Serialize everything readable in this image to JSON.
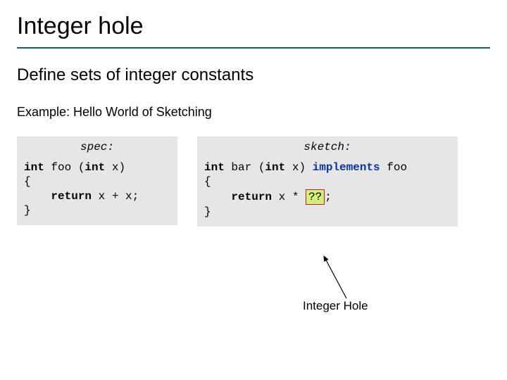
{
  "title": "Integer hole",
  "subtitle": "Define sets of integer constants",
  "example_label": "Example: Hello World of Sketching",
  "left": {
    "label": "spec:",
    "l1a": "int",
    "l1b": " foo (",
    "l1c": "int",
    "l1d": " x)",
    "l2": "{",
    "l3a": "    ",
    "l3b": "return",
    "l3c": " x + x;",
    "l4": "}"
  },
  "right": {
    "label": "sketch:",
    "l1a": "int",
    "l1b": " bar (",
    "l1c": "int",
    "l1d": " x) ",
    "l1e": "implements",
    "l1f": " foo",
    "l2": "{",
    "l3a": "    ",
    "l3b": "return",
    "l3c": " x * ",
    "l3d": "??",
    "l3e": ";",
    "l4": "}"
  },
  "annotation": "Integer Hole"
}
